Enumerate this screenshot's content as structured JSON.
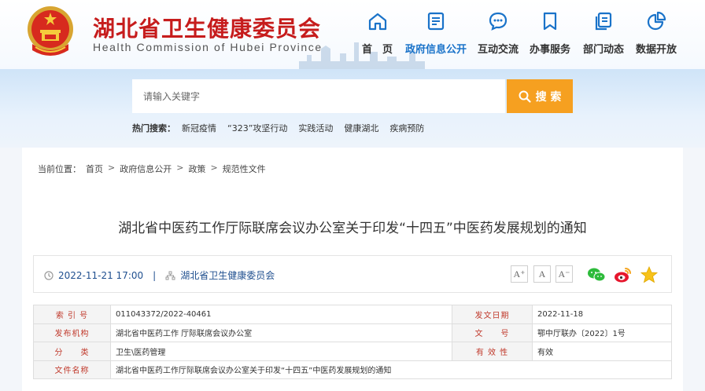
{
  "header": {
    "title": "湖北省卫生健康委员会",
    "subtitle": "Health Commission of Hubei Province",
    "nav": [
      {
        "label": "首　页",
        "icon": "home-icon"
      },
      {
        "label": "政府信息公开",
        "icon": "document-icon",
        "active": true
      },
      {
        "label": "互动交流",
        "icon": "chat-icon"
      },
      {
        "label": "办事服务",
        "icon": "bookmark-icon"
      },
      {
        "label": "部门动态",
        "icon": "copy-icon"
      },
      {
        "label": "数据开放",
        "icon": "pie-chart-icon"
      }
    ],
    "accent": "#1a73c9",
    "brand": "#c61c1c"
  },
  "search": {
    "placeholder": "请输入关键字",
    "button": "搜 索",
    "hot_label": "热门搜索：",
    "hot_terms": [
      "新冠疫情",
      "“323”攻坚行动",
      "实践活动",
      "健康湖北",
      "疾病预防"
    ]
  },
  "breadcrumb": {
    "label": "当前位置：",
    "items": [
      "首页",
      "政府信息公开",
      "政策",
      "规范性文件"
    ]
  },
  "article": {
    "title": "湖北省中医药工作厅际联席会议办公室关于印发“十四五”中医药发展规划的通知",
    "datetime": "2022-11-21 17:00",
    "divider": "|",
    "source": "湖北省卫生健康委员会",
    "font_sizes": [
      "A⁺",
      "A",
      "A⁻"
    ]
  },
  "info_table": {
    "rows": [
      {
        "k1": "索 引 号",
        "v1": "011043372/2022-40461",
        "k2": "发文日期",
        "v2": "2022-11-18"
      },
      {
        "k1": "发布机构",
        "v1": "湖北省中医药工作 厅际联席会议办公室",
        "k2": "文　　号",
        "v2": "鄂中厅联办〔2022〕1号"
      },
      {
        "k1": "分　　类",
        "v1": "卫生\\医药管理",
        "k2": "有 效 性",
        "v2": "有效"
      },
      {
        "k1": "文件名称",
        "v1": "湖北省中医药工作厅际联席会议办公室关于印发“十四五”中医药发展规划的通知"
      }
    ]
  }
}
